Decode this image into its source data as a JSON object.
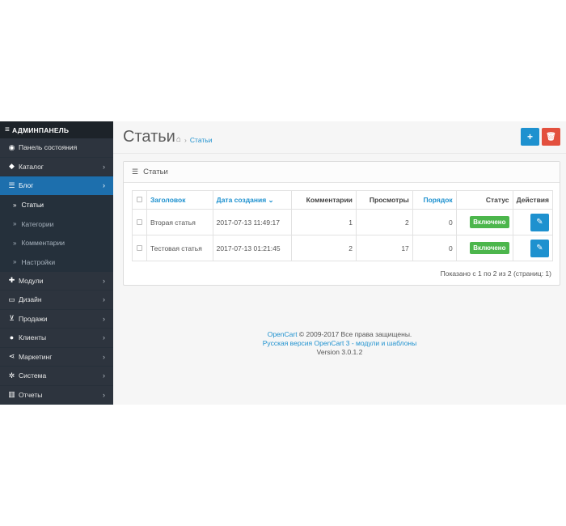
{
  "sidebar": {
    "header": "АДМИНПАНЕЛЬ",
    "items": [
      {
        "label": "Панель состояния",
        "icon": "dashboard-icon",
        "glyph": "◉",
        "chevron": false
      },
      {
        "label": "Каталог",
        "icon": "tag-icon",
        "glyph": "◆",
        "chevron": true
      },
      {
        "label": "Блог",
        "icon": "list-icon",
        "glyph": "☰",
        "chevron": true,
        "active": true
      },
      {
        "label": "Модули",
        "icon": "puzzle-icon",
        "glyph": "✚",
        "chevron": true
      },
      {
        "label": "Дизайн",
        "icon": "monitor-icon",
        "glyph": "▭",
        "chevron": true
      },
      {
        "label": "Продажи",
        "icon": "cart-icon",
        "glyph": "⊻",
        "chevron": true
      },
      {
        "label": "Клиенты",
        "icon": "user-icon",
        "glyph": "●",
        "chevron": true
      },
      {
        "label": "Маркетинг",
        "icon": "share-icon",
        "glyph": "⋖",
        "chevron": true
      },
      {
        "label": "Система",
        "icon": "gear-icon",
        "glyph": "✲",
        "chevron": true
      },
      {
        "label": "Отчеты",
        "icon": "bar-chart-icon",
        "glyph": "▥",
        "chevron": true
      }
    ],
    "blog_sub": [
      "Статьи",
      "Категории",
      "Комментарии",
      "Настройки"
    ]
  },
  "header": {
    "title": "Статьи",
    "breadcrumb": "Статьи",
    "add_glyph": "+",
    "delete_glyph": "🗑"
  },
  "panel": {
    "title": "Статьи",
    "columns": [
      "Заголовок",
      "Дата создания ⌄",
      "Комментарии",
      "Просмотры",
      "Порядок",
      "Статус",
      "Действия"
    ],
    "rows": [
      {
        "title": "Вторая статья",
        "date": "2017-07-13 11:49:17",
        "comments": "1",
        "views": "2",
        "order": "0",
        "status": "Включено"
      },
      {
        "title": "Тестовая статья",
        "date": "2017-07-13 01:21:45",
        "comments": "2",
        "views": "17",
        "order": "0",
        "status": "Включено"
      }
    ],
    "pager": "Показано с 1 по 2 из 2 (страниц: 1)"
  },
  "footer": {
    "brand": "OpenCart",
    "copyright": " © 2009-2017 Все права защищены.",
    "russian": "Русская версия OpenCart 3 - модули и шаблоны",
    "version": "Version 3.0.1.2"
  },
  "colors": {
    "sidebar": "#2d343e",
    "accent": "#1e91cf",
    "success": "#4cb64c",
    "danger": "#e3503e"
  }
}
